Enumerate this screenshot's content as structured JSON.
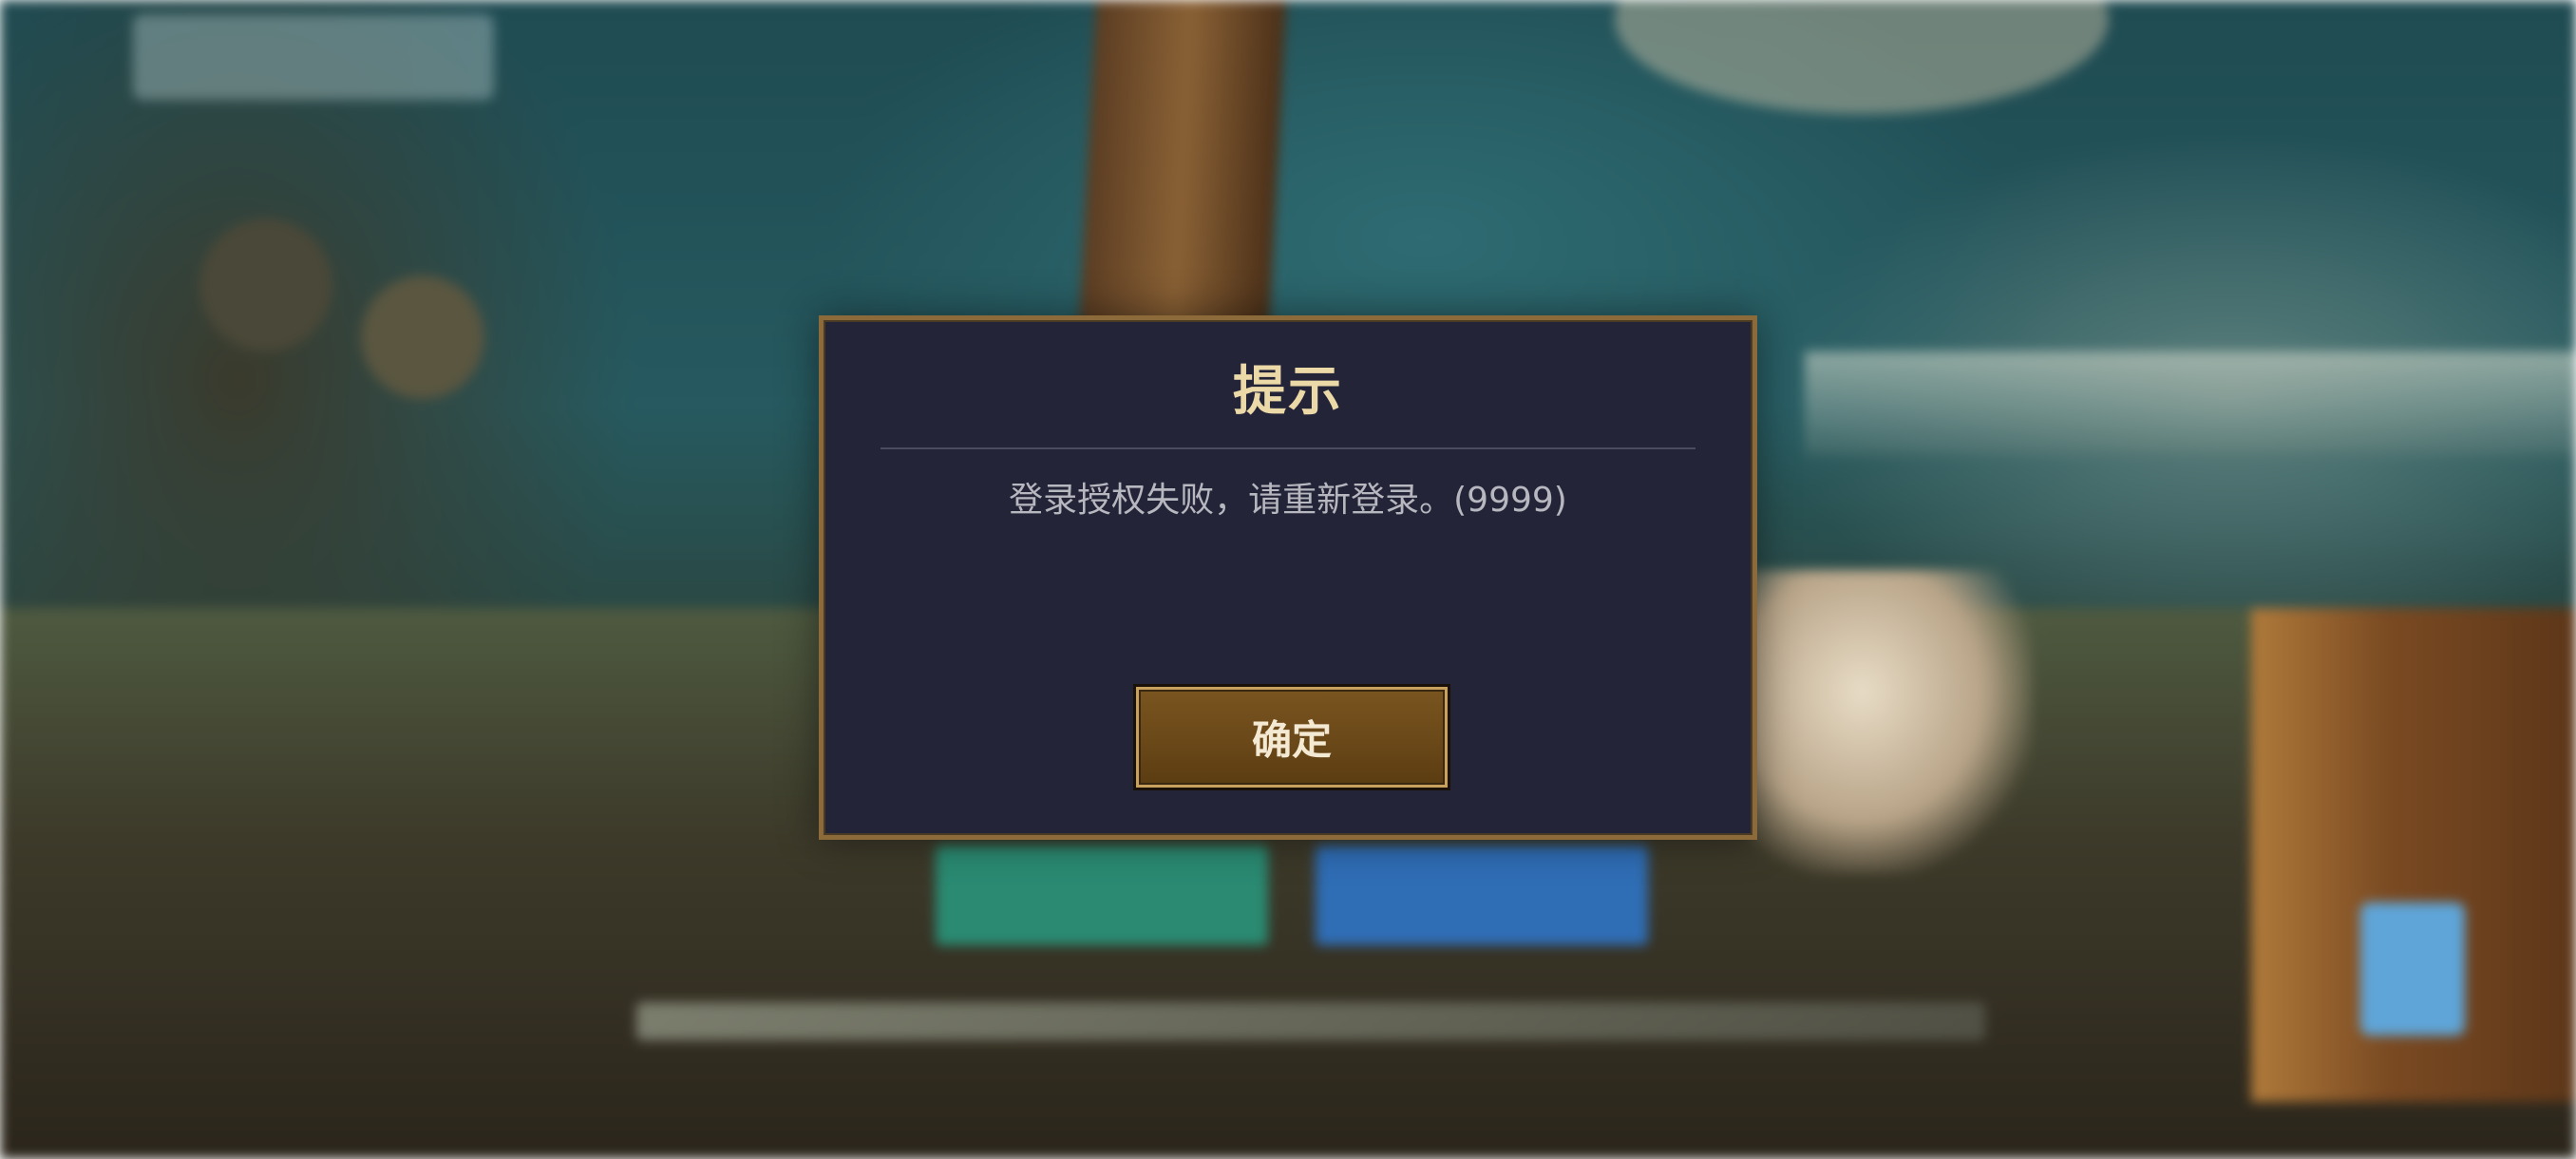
{
  "dialog": {
    "title": "提示",
    "message": "登录授权失败，请重新登录。(9999)",
    "confirm_label": "确定"
  },
  "colors": {
    "dialog_background": "#232438",
    "dialog_border": "#8c6a3a",
    "title_color": "#ecd9a8",
    "message_color": "#b7b7bf",
    "button_background": "#6a4818",
    "button_text": "#f4e9d2"
  }
}
